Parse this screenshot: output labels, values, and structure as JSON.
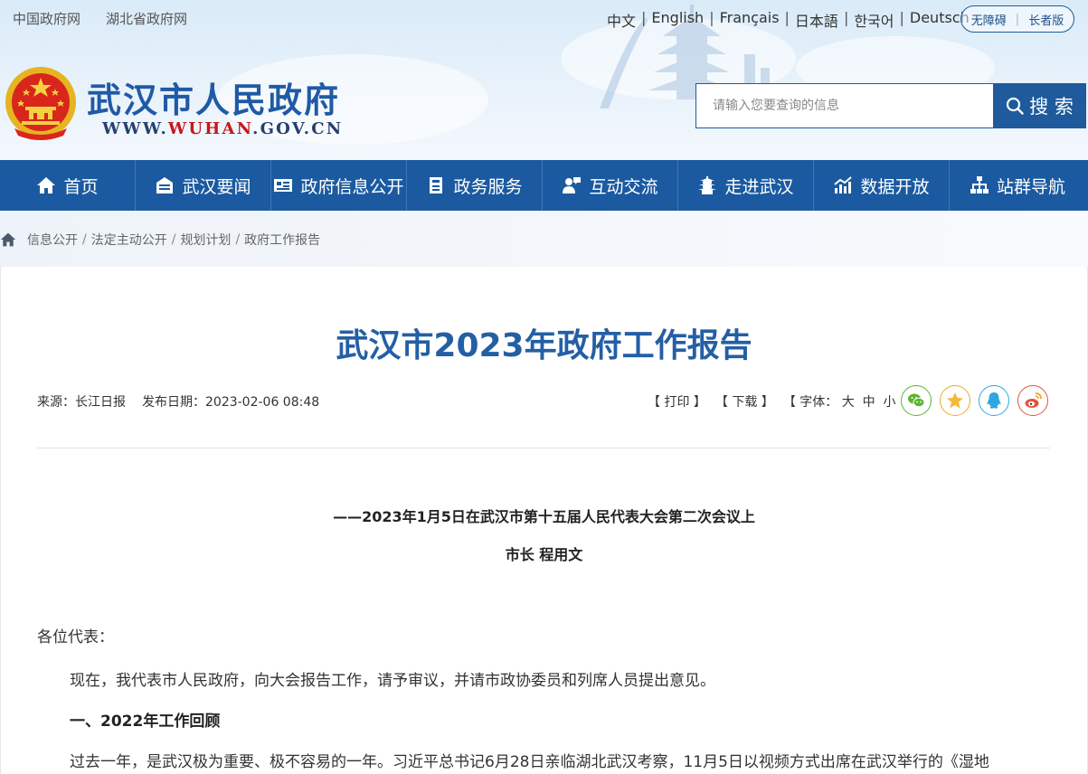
{
  "header": {
    "top_links": [
      "中国政府网",
      "湖北省政府网"
    ],
    "languages": [
      "中文",
      "English",
      "Français",
      "日本語",
      "한국어",
      "Deutsch"
    ],
    "accessibility": [
      "无障碍",
      "长者版"
    ],
    "site_title": "武汉市人民政府",
    "site_url_prefix": "WWW.",
    "site_url_domain": "WUHAN",
    "site_url_suffix": ".GOV.CN",
    "search_placeholder": "请输入您要查询的信息",
    "search_button": "搜 索"
  },
  "nav": {
    "items": [
      {
        "label": "首页",
        "icon": "home-icon"
      },
      {
        "label": "武汉要闻",
        "icon": "news-icon"
      },
      {
        "label": "政府信息公开",
        "icon": "info-card-icon"
      },
      {
        "label": "政务服务",
        "icon": "service-icon"
      },
      {
        "label": "互动交流",
        "icon": "interact-icon"
      },
      {
        "label": "走进武汉",
        "icon": "tower-icon"
      },
      {
        "label": "数据开放",
        "icon": "chart-icon"
      },
      {
        "label": "站群导航",
        "icon": "sitemap-icon"
      }
    ]
  },
  "breadcrumb": {
    "items": [
      "信息公开",
      "法定主动公开",
      "规划计划",
      "政府工作报告"
    ],
    "separator": "/"
  },
  "article": {
    "title": "武汉市2023年政府工作报告",
    "source": "来源：长江日报",
    "date": "发布日期：2023-02-06 08:48",
    "tools": {
      "print": "【 打印 】",
      "download": "【 下载 】",
      "font_label": "【 字体：",
      "font_large": "大",
      "font_medium": "中",
      "font_small": "小",
      "font_close": "】"
    },
    "share_icons": [
      "wechat-icon",
      "favorite-icon",
      "qq-icon",
      "weibo-icon"
    ],
    "share_colors": {
      "wechat": "#5cb531",
      "favorite": "#f0a830",
      "qq": "#2ea7e0",
      "weibo": "#e6533c"
    },
    "subtitle_line1": "——2023年1月5日在武汉市第十五届人民代表大会第二次会议上",
    "subtitle_line2": "市长  程用文",
    "paragraphs": [
      "各位代表：",
      "现在，我代表市人民政府，向大会报告工作，请予审议，并请市政协委员和列席人员提出意见。",
      "一、2022年工作回顾",
      "过去一年，是武汉极为重要、极不容易的一年。习近平总书记6月28日亲临湖北武汉考察，11月5日以视频方式出席在武汉举行的《湿地"
    ]
  },
  "colors": {
    "brand_blue": "#1b5aa0",
    "title_blue": "#235fa5",
    "accent_red": "#c8161d"
  }
}
